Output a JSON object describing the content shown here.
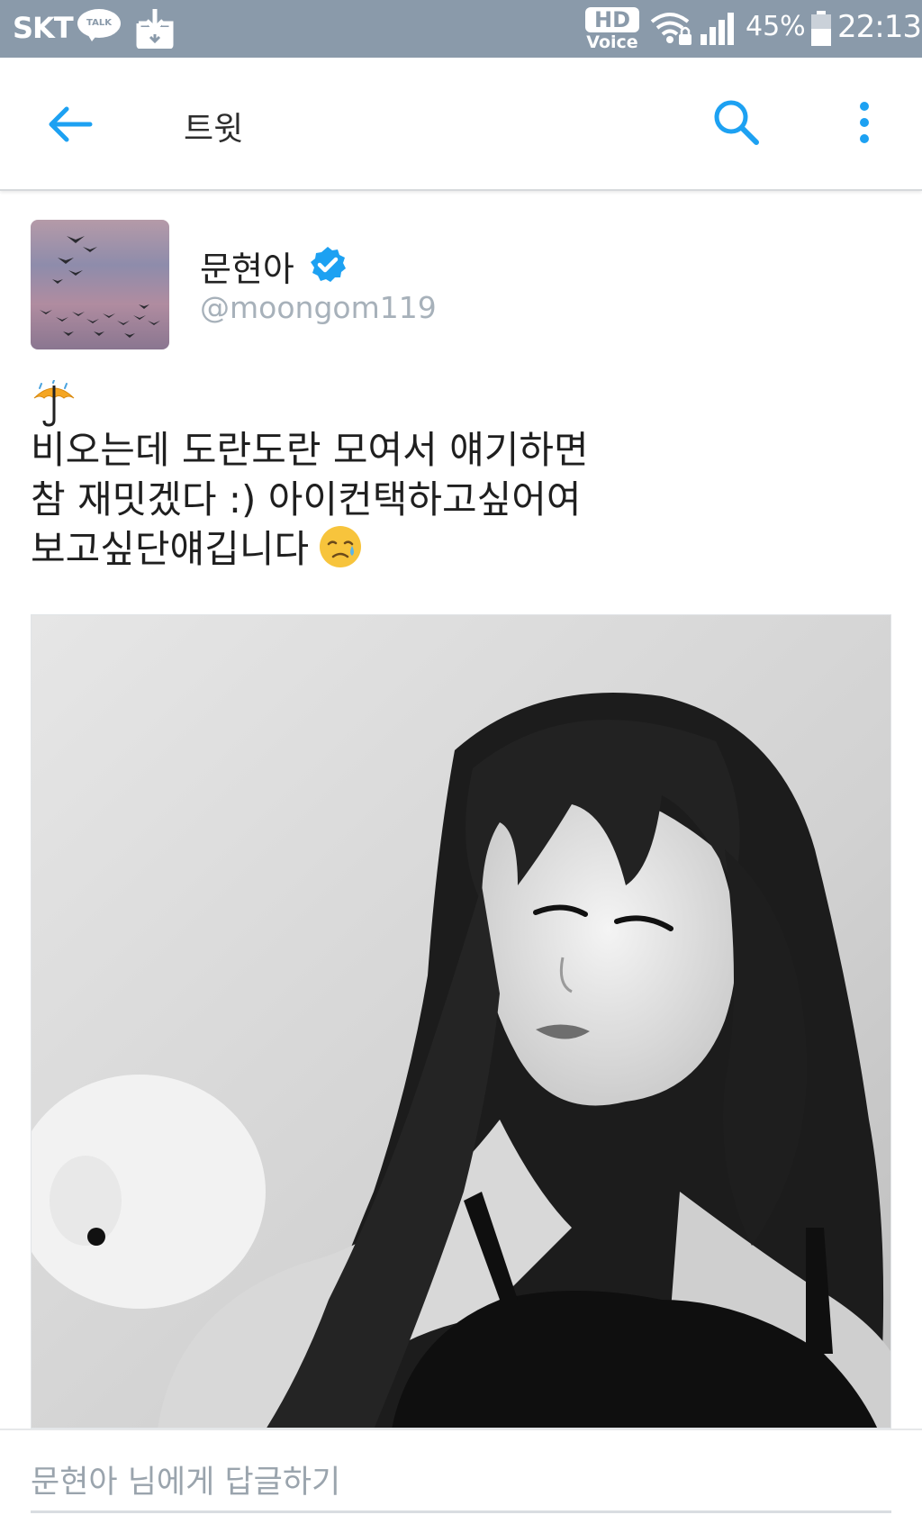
{
  "status_bar": {
    "carrier": "SKT",
    "talk_badge": "TALK",
    "hd": "HD",
    "voice": "Voice",
    "battery_percent": "45%",
    "time": "22:13",
    "icons": [
      "kakaotalk-icon",
      "download-icon",
      "hd-voice-icon",
      "wifi-lock-icon",
      "signal-icon",
      "battery-icon"
    ]
  },
  "app_bar": {
    "title": "트윗",
    "icons": [
      "back-arrow-icon",
      "search-icon",
      "more-vert-icon"
    ],
    "accent_color": "#1da1f2"
  },
  "tweet": {
    "author_name": "문현아",
    "author_handle": "@moongom119",
    "verified": true,
    "text_lines": [
      "비오는데 도란도란 모여서 얘기하면",
      "참 재밋겠다 :) 아이컨택하고싶어여",
      "보고싶단얘깁니다"
    ],
    "emojis": [
      "umbrella-rain-emoji",
      "disappointed-relieved-emoji"
    ]
  },
  "reply": {
    "placeholder": "문현아 님에게 답글하기"
  }
}
